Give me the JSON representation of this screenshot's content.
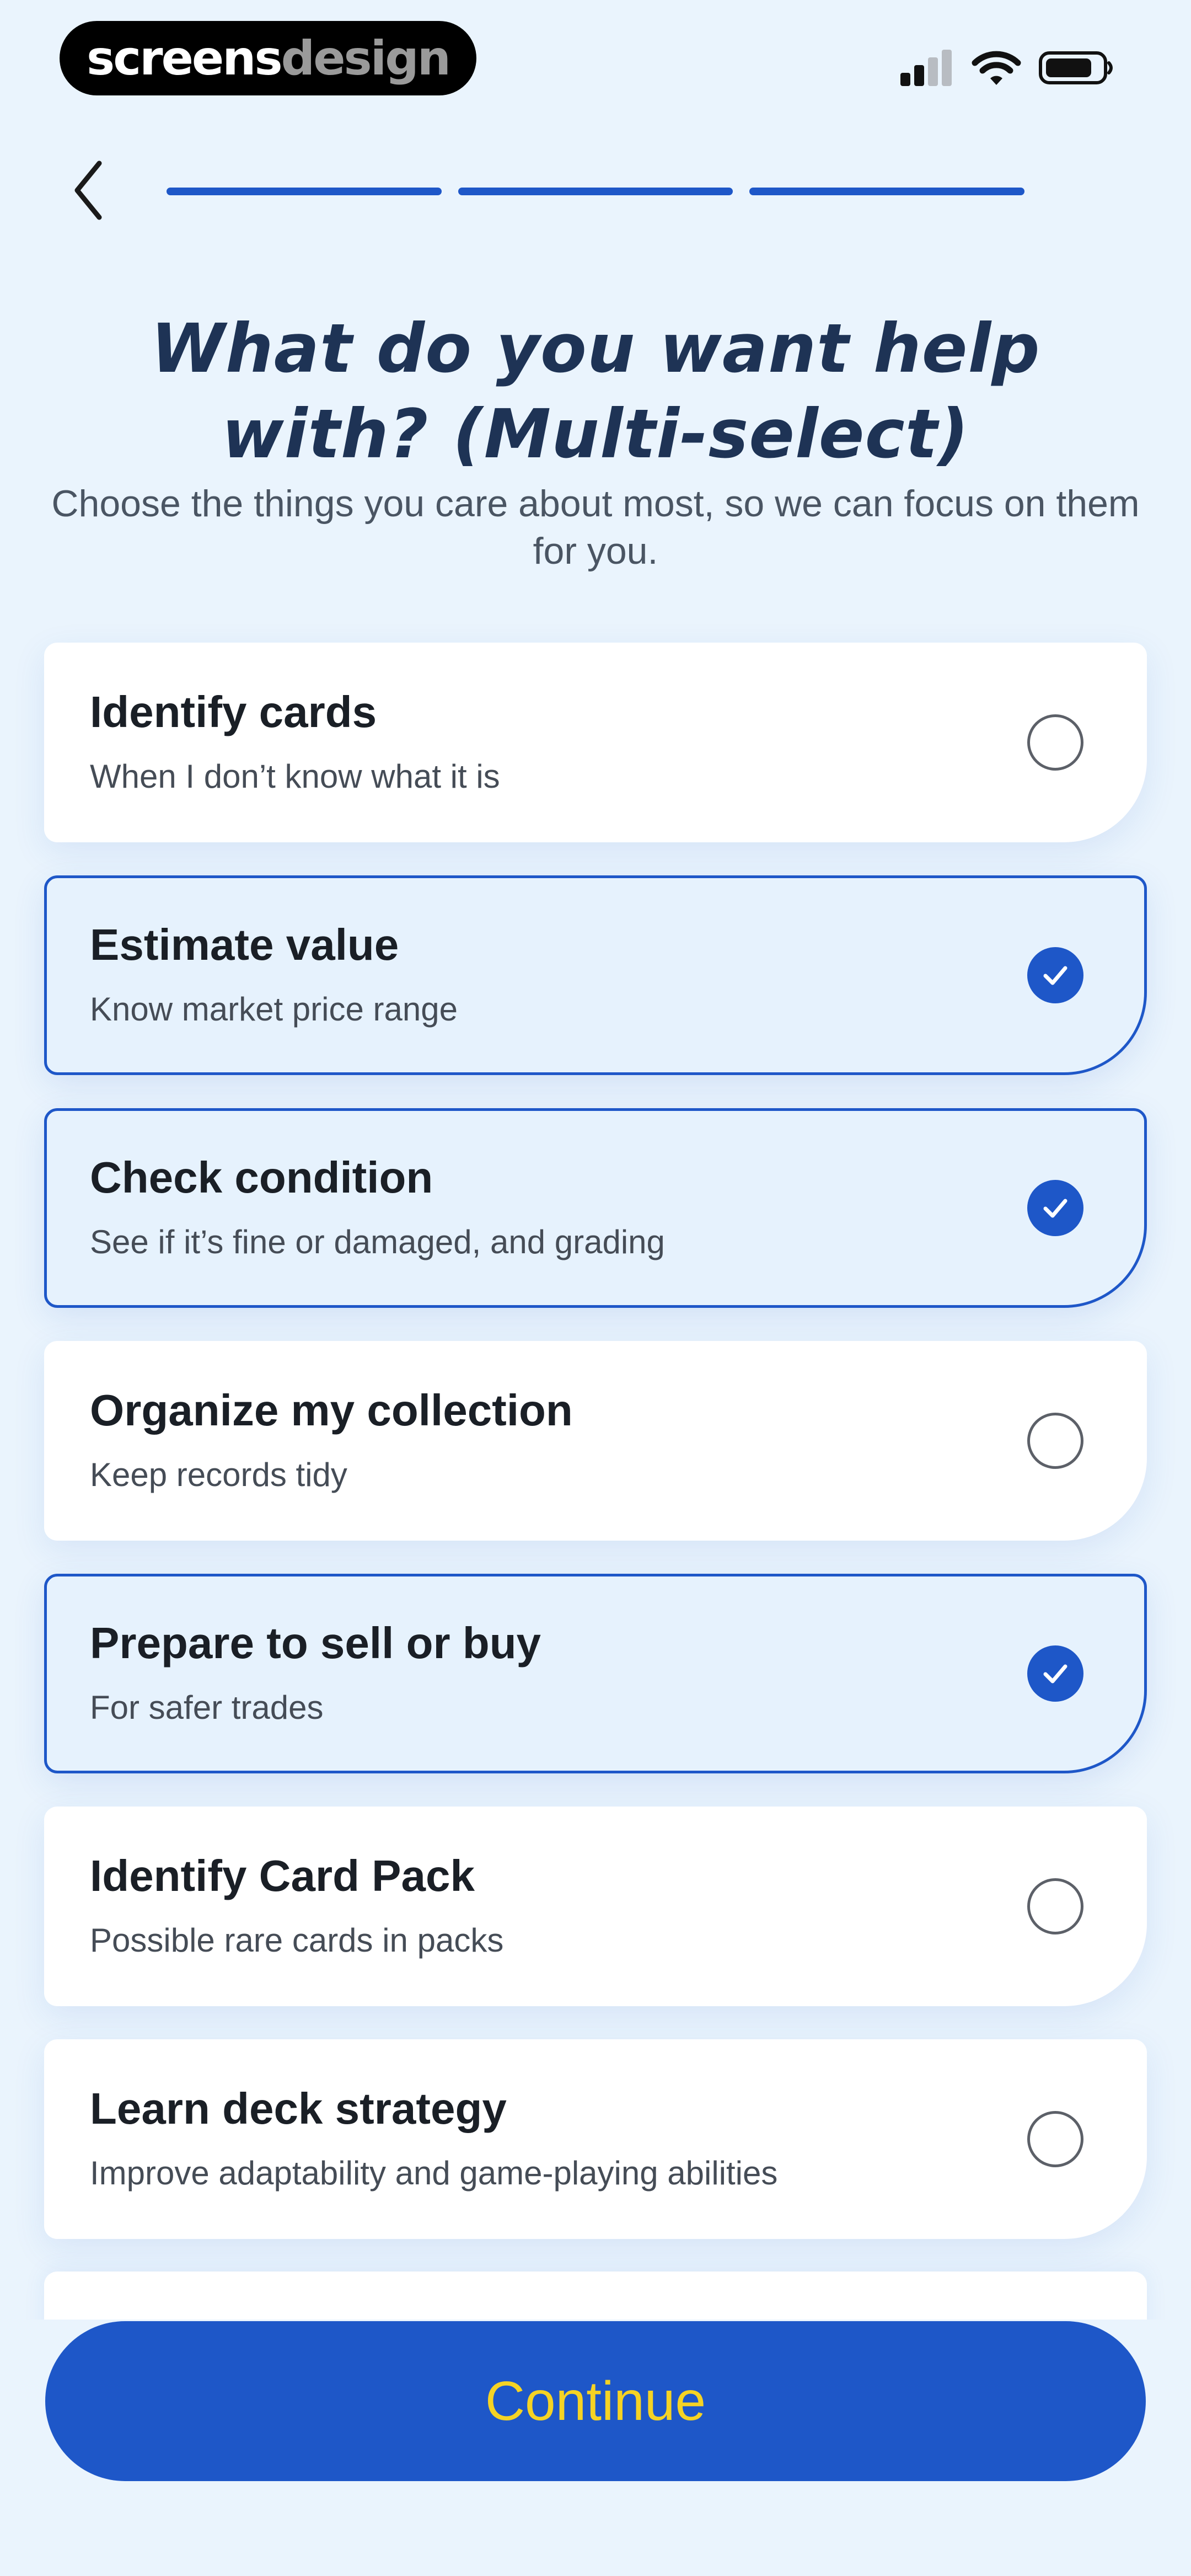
{
  "status_bar": {
    "brand_part1": "screens",
    "brand_part2": "design",
    "icons": [
      "cellular-signal-icon",
      "wifi-icon",
      "battery-icon"
    ]
  },
  "nav": {
    "back_icon": "chevron-left-icon",
    "progress_steps_completed": 3,
    "progress_steps_total": 3
  },
  "header": {
    "title": "What do you want help with? (Multi-select)",
    "subtitle": "Choose the things you care about most, so we can focus on them for you."
  },
  "options": [
    {
      "title": "Identify cards",
      "description": "When I don’t know what it is",
      "selected": false
    },
    {
      "title": "Estimate value",
      "description": "Know market price range",
      "selected": true
    },
    {
      "title": "Check condition",
      "description": "See if it’s fine or damaged, and grading",
      "selected": true
    },
    {
      "title": "Organize my collection",
      "description": "Keep records tidy",
      "selected": false
    },
    {
      "title": "Prepare to sell or buy",
      "description": "For safer trades",
      "selected": true
    },
    {
      "title": "Identify Card Pack",
      "description": "Possible rare cards in packs",
      "selected": false
    },
    {
      "title": "Learn deck strategy",
      "description": "Improve adaptability and game-playing abilities",
      "selected": false
    }
  ],
  "footer": {
    "continue_label": "Continue"
  },
  "colors": {
    "background": "#eaf4fd",
    "accent": "#1e57c8",
    "button_text": "#f5d324",
    "title": "#1e3355"
  }
}
